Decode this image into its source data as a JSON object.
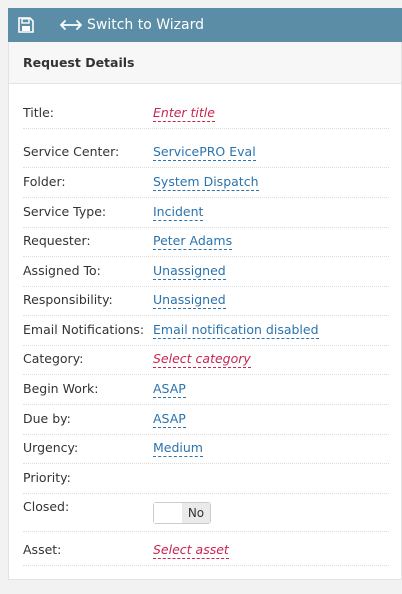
{
  "toolbar": {
    "switch_label": "Switch to Wizard"
  },
  "panel": {
    "title": "Request Details"
  },
  "fields": {
    "title": {
      "label": "Title:",
      "value": "Enter title"
    },
    "service_center": {
      "label": "Service Center:",
      "value": "ServicePRO Eval"
    },
    "folder": {
      "label": "Folder:",
      "value": "System Dispatch"
    },
    "service_type": {
      "label": "Service Type:",
      "value": "Incident"
    },
    "requester": {
      "label": "Requester:",
      "value": "Peter Adams"
    },
    "assigned_to": {
      "label": "Assigned To:",
      "value": "Unassigned"
    },
    "responsibility": {
      "label": "Responsibility:",
      "value": "Unassigned"
    },
    "email_notifications": {
      "label": "Email Notifications:",
      "value": "Email notification disabled"
    },
    "category": {
      "label": "Category:",
      "value": "Select category"
    },
    "begin_work": {
      "label": "Begin Work:",
      "value": "ASAP"
    },
    "due_by": {
      "label": "Due by:",
      "value": "ASAP"
    },
    "urgency": {
      "label": "Urgency:",
      "value": "Medium"
    },
    "priority": {
      "label": "Priority:",
      "value": ""
    },
    "closed": {
      "label": "Closed:",
      "value": "No"
    },
    "asset": {
      "label": "Asset:",
      "value": "Select asset"
    }
  },
  "colors": {
    "toolbar_bg": "#5b8ea6",
    "link": "#2a73ad",
    "placeholder": "#c7254e"
  },
  "icons": [
    "save-icon",
    "switch-arrows-icon"
  ]
}
